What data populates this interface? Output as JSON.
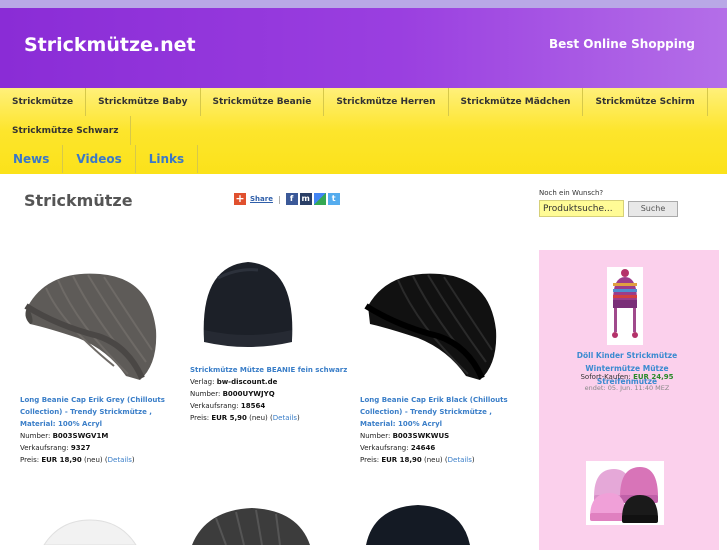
{
  "header": {
    "site_title": "Strickmütze.net",
    "tagline": "Best Online Shopping"
  },
  "nav": {
    "row1": [
      "Strickmütze",
      "Strickmütze Baby",
      "Strickmütze Beanie",
      "Strickmütze Herren",
      "Strickmütze Mädchen",
      "Strickmütze Schirm"
    ],
    "row2": [
      "Strickmütze Schwarz"
    ],
    "row3": [
      "News",
      "Videos",
      "Links"
    ]
  },
  "page": {
    "title": "Strickmütze",
    "share_label": "Share",
    "share_sep": "|"
  },
  "search": {
    "label": "Noch ein Wunsch?",
    "value": "Produktsuche...",
    "button": "Suche"
  },
  "sidebar": {
    "item1": {
      "title": "Döll Kinder Strickmütze Wintermütze Mütze Streifenmütze",
      "price_label": "Sofort-Kaufen:",
      "price": "EUR 24,95",
      "date": "endet: 05. Jun. 11:40 MEZ"
    }
  },
  "products": [
    {
      "title": "Long Beanie Cap Erik Grey (Chillouts Collection) - Trendy Strickmütze , Material: 100% Acryl",
      "number_label": "Number:",
      "number": "B003SWGV1M",
      "rank_label": "Verkaufsrang:",
      "rank": "9327",
      "price_label": "Preis:",
      "price": "EUR 18,90",
      "condition": "(neu)",
      "details": "Details"
    },
    {
      "title": "Strickmütze Mütze BEANIE fein schwarz",
      "publisher_label": "Verlag:",
      "publisher": "bw-discount.de",
      "number_label": "Number:",
      "number": "B000UYWJYQ",
      "rank_label": "Verkaufsrang:",
      "rank": "18564",
      "price_label": "Preis:",
      "price": "EUR 5,90",
      "condition": "(neu)",
      "details": "Details"
    },
    {
      "title": "Long Beanie Cap Erik Black (Chillouts Collection) - Trendy Strickmütze , Material: 100% Acryl",
      "number_label": "Number:",
      "number": "B003SWKWUS",
      "rank_label": "Verkaufsrang:",
      "rank": "24646",
      "price_label": "Preis:",
      "price": "EUR 18,90",
      "condition": "(neu)",
      "details": "Details"
    }
  ],
  "colors": {
    "header_purple": "#8a2cd6",
    "nav_yellow": "#fde52c",
    "link_blue": "#3a7ec8",
    "sidebar_pink": "#fbd0ec"
  }
}
